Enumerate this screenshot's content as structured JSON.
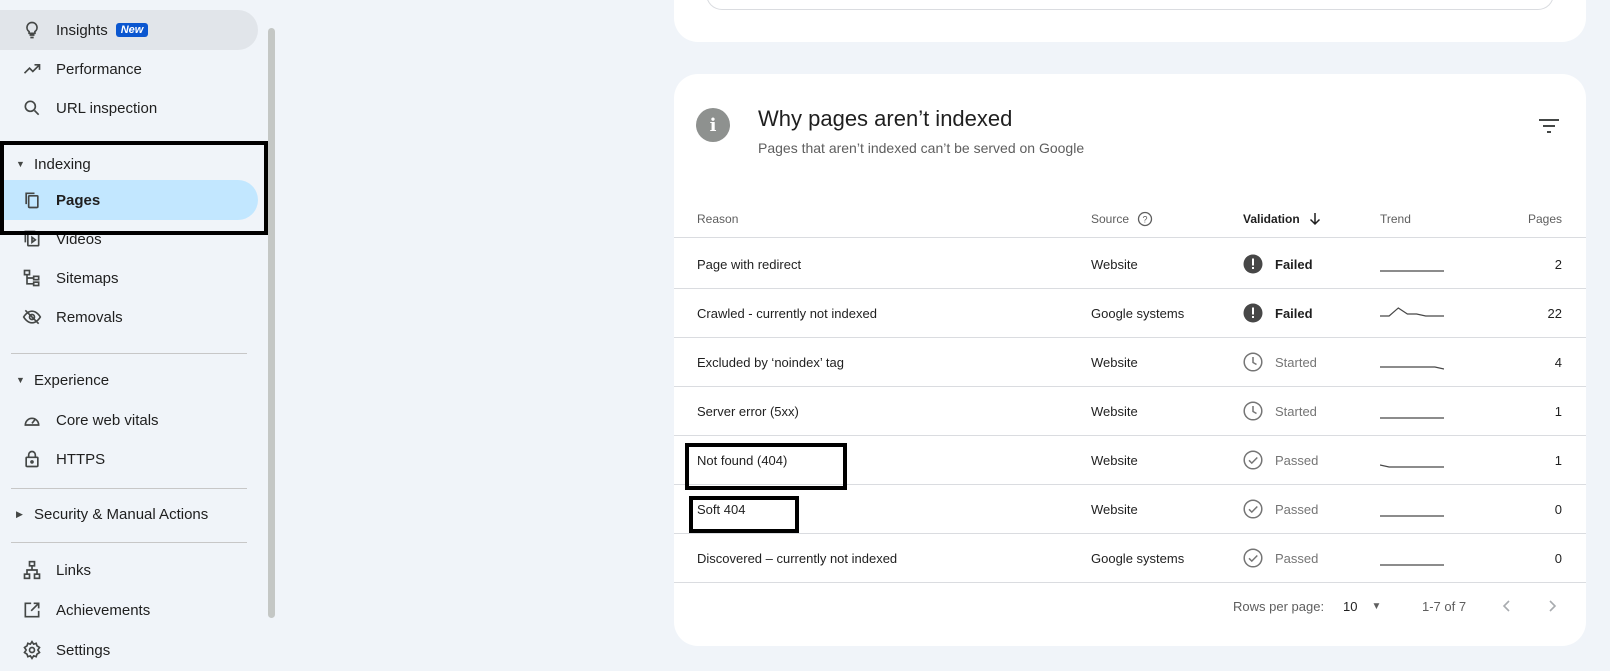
{
  "sidebar": {
    "items": [
      {
        "label": "Insights",
        "badge": "New",
        "icon": "lightbulb-icon"
      },
      {
        "label": "Performance",
        "icon": "trending-up-icon"
      },
      {
        "label": "URL inspection",
        "icon": "search-icon"
      }
    ],
    "indexing": {
      "title": "Indexing",
      "items": [
        {
          "label": "Pages",
          "icon": "pages-icon"
        },
        {
          "label": "Videos",
          "icon": "video-icon"
        },
        {
          "label": "Sitemaps",
          "icon": "sitemap-icon"
        },
        {
          "label": "Removals",
          "icon": "eye-off-icon"
        }
      ]
    },
    "experience": {
      "title": "Experience",
      "items": [
        {
          "label": "Core web vitals",
          "icon": "speedometer-icon"
        },
        {
          "label": "HTTPS",
          "icon": "lock-icon"
        }
      ]
    },
    "security": {
      "title": "Security & Manual Actions"
    },
    "bottom_items": [
      {
        "label": "Links",
        "icon": "links-icon"
      },
      {
        "label": "Achievements",
        "icon": "open-external-icon"
      },
      {
        "label": "Settings",
        "icon": "gear-icon"
      }
    ]
  },
  "card": {
    "title": "Why pages aren’t indexed",
    "subtitle": "Pages that aren’t indexed can’t be served on Google",
    "columns": {
      "reason": "Reason",
      "source": "Source",
      "validation": "Validation",
      "trend": "Trend",
      "pages": "Pages"
    },
    "rows": [
      {
        "reason": "Page with redirect",
        "source": "Website",
        "validation": "Failed",
        "status": "failed",
        "pages": "2",
        "trend": [
          0,
          0,
          0,
          0,
          0,
          0,
          0,
          0
        ]
      },
      {
        "reason": "Crawled - currently not indexed",
        "source": "Google systems",
        "validation": "Failed",
        "status": "failed",
        "pages": "22",
        "trend": [
          2,
          2,
          6,
          3,
          3,
          2,
          2,
          2
        ]
      },
      {
        "reason": "Excluded by ‘noindex’ tag",
        "source": "Website",
        "validation": "Started",
        "status": "started",
        "pages": "4",
        "trend": [
          1,
          1,
          1,
          1,
          1,
          1,
          1,
          0
        ]
      },
      {
        "reason": "Server error (5xx)",
        "source": "Website",
        "validation": "Started",
        "status": "started",
        "pages": "1",
        "trend": [
          0,
          0,
          0,
          0,
          0,
          0,
          0,
          0
        ]
      },
      {
        "reason": "Not found (404)",
        "source": "Website",
        "validation": "Passed",
        "status": "passed",
        "pages": "1",
        "trend": [
          1,
          0,
          0,
          0,
          0,
          0,
          0,
          0
        ]
      },
      {
        "reason": "Soft 404",
        "source": "Website",
        "validation": "Passed",
        "status": "passed",
        "pages": "0",
        "trend": [
          0,
          0,
          0,
          0,
          0,
          0,
          0,
          0
        ]
      },
      {
        "reason": "Discovered – currently not indexed",
        "source": "Google systems",
        "validation": "Passed",
        "status": "passed",
        "pages": "0",
        "trend": [
          0,
          0,
          0,
          0,
          0,
          0,
          0,
          0
        ]
      }
    ],
    "footer": {
      "rows_per_page_label": "Rows per page:",
      "rows_per_page_value": "10",
      "range": "1-7 of 7"
    }
  }
}
